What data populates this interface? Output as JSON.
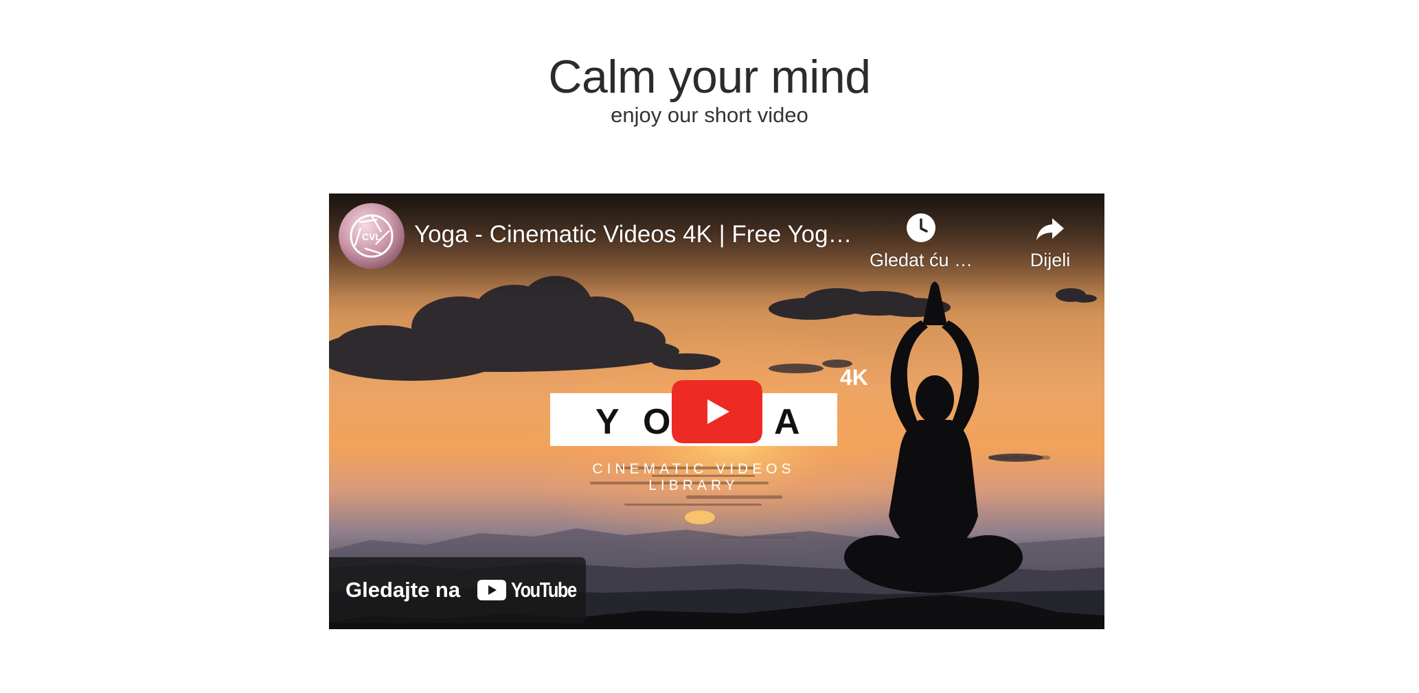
{
  "hero": {
    "title": "Calm your mind",
    "subtitle": "enjoy our short video"
  },
  "video": {
    "title": "Yoga - Cinematic Videos 4K | Free Yog…",
    "channel_avatar_text": "CVL",
    "thumbnail": {
      "brand_word": "YOGA",
      "brand_tagline": "CINEMATIC VIDEOS LIBRARY",
      "quality_badge": "4K"
    },
    "actions": {
      "watch_later_label": "Gledat ću …",
      "watch_later_icon": "clock-icon",
      "share_label": "Dijeli",
      "share_icon": "share-arrow-icon"
    },
    "play_icon": "play-icon",
    "watch_on": {
      "text": "Gledajte na",
      "platform": "YouTube"
    },
    "colors": {
      "play_red": "#ee2a24",
      "overlay_dark": "#171717"
    }
  }
}
